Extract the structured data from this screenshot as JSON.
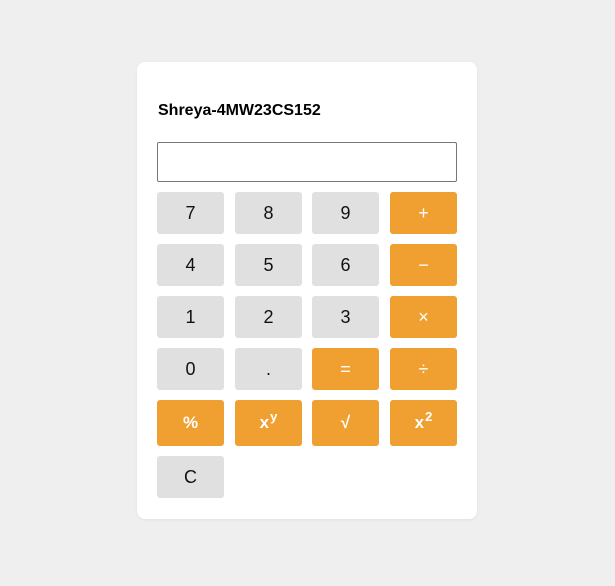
{
  "calculator": {
    "title": "Shreya-4MW23CS152",
    "display_value": "",
    "colors": {
      "number_button": "#e0e0e0",
      "operator_button": "#f0a030",
      "background": "#efefef",
      "card": "#ffffff"
    },
    "buttons": {
      "seven": "7",
      "eight": "8",
      "nine": "9",
      "plus": "+",
      "four": "4",
      "five": "5",
      "six": "6",
      "minus": "−",
      "one": "1",
      "two": "2",
      "three": "3",
      "multiply": "×",
      "zero": "0",
      "dot": ".",
      "equals": "=",
      "divide": "÷",
      "percent": "%",
      "power_base": "x",
      "power_exp": "y",
      "sqrt": "√",
      "square_base": "x",
      "square_exp": "2",
      "clear": "C"
    }
  }
}
